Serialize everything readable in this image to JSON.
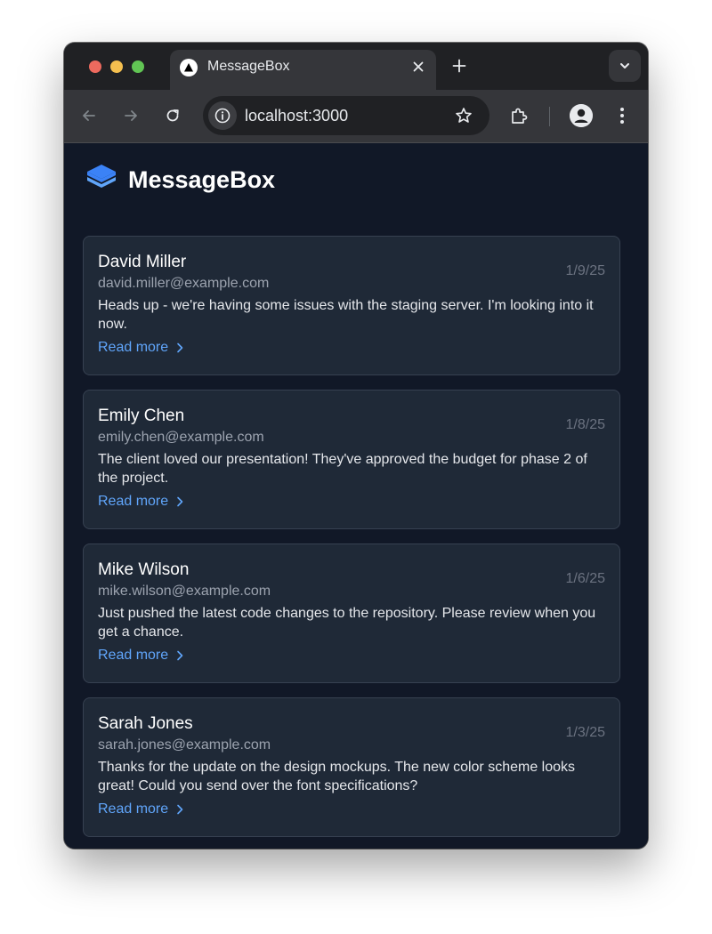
{
  "browser": {
    "tab_title": "MessageBox",
    "url": "localhost:3000",
    "icons": [
      "back-icon",
      "forward-icon",
      "reload-icon",
      "site-info-icon",
      "star-icon",
      "extensions-icon",
      "profile-icon",
      "menu-icon",
      "new-tab-icon",
      "close-icon",
      "chevron-down-icon"
    ]
  },
  "app": {
    "title": "MessageBox",
    "logo_icon": "stacked-layers-icon",
    "accent_color": "#60a5fa",
    "logo_color": "#3b82f6"
  },
  "messages": [
    {
      "sender": "David Miller",
      "email": "david.miller@example.com",
      "date": "1/9/25",
      "preview": "Heads up - we're having some issues with the staging server. I'm looking into it now.",
      "action": "Read more"
    },
    {
      "sender": "Emily Chen",
      "email": "emily.chen@example.com",
      "date": "1/8/25",
      "preview": "The client loved our presentation! They've approved the budget for phase 2 of the project.",
      "action": "Read more"
    },
    {
      "sender": "Mike Wilson",
      "email": "mike.wilson@example.com",
      "date": "1/6/25",
      "preview": "Just pushed the latest code changes to the repository. Please review when you get a chance.",
      "action": "Read more"
    },
    {
      "sender": "Sarah Jones",
      "email": "sarah.jones@example.com",
      "date": "1/3/25",
      "preview": "Thanks for the update on the design mockups. The new color scheme looks great! Could you send over the font specifications?",
      "action": "Read more"
    }
  ]
}
